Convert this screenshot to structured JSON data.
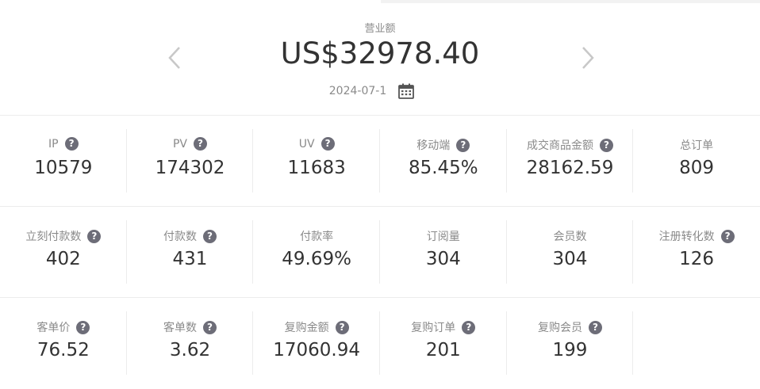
{
  "header": {
    "label": "营业额",
    "amount": "US$32978.40",
    "date": "2024-07-1"
  },
  "icons": {
    "prev": "chevron-left-icon",
    "next": "chevron-right-icon",
    "calendar": "calendar-icon",
    "help": "question-circle-icon",
    "help_glyph": "?"
  },
  "colors": {
    "help_badge": "#6d6d78",
    "label": "#8a8a8a",
    "value": "#333333"
  },
  "rows": [
    [
      {
        "label": "IP",
        "value": "10579",
        "help": true
      },
      {
        "label": "PV",
        "value": "174302",
        "help": true
      },
      {
        "label": "UV",
        "value": "11683",
        "help": true
      },
      {
        "label": "移动端",
        "value": "85.45%",
        "help": true
      },
      {
        "label": "成交商品金额",
        "value": "28162.59",
        "help": true
      },
      {
        "label": "总订单",
        "value": "809",
        "help": false
      }
    ],
    [
      {
        "label": "立刻付款数",
        "value": "402",
        "help": true
      },
      {
        "label": "付款数",
        "value": "431",
        "help": true
      },
      {
        "label": "付款率",
        "value": "49.69%",
        "help": false
      },
      {
        "label": "订阅量",
        "value": "304",
        "help": false
      },
      {
        "label": "会员数",
        "value": "304",
        "help": false
      },
      {
        "label": "注册转化数",
        "value": "126",
        "help": true
      }
    ],
    [
      {
        "label": "客单价",
        "value": "76.52",
        "help": true
      },
      {
        "label": "客单数",
        "value": "3.62",
        "help": true
      },
      {
        "label": "复购金额",
        "value": "17060.94",
        "help": true
      },
      {
        "label": "复购订单",
        "value": "201",
        "help": true
      },
      {
        "label": "复购会员",
        "value": "199",
        "help": true
      }
    ]
  ]
}
